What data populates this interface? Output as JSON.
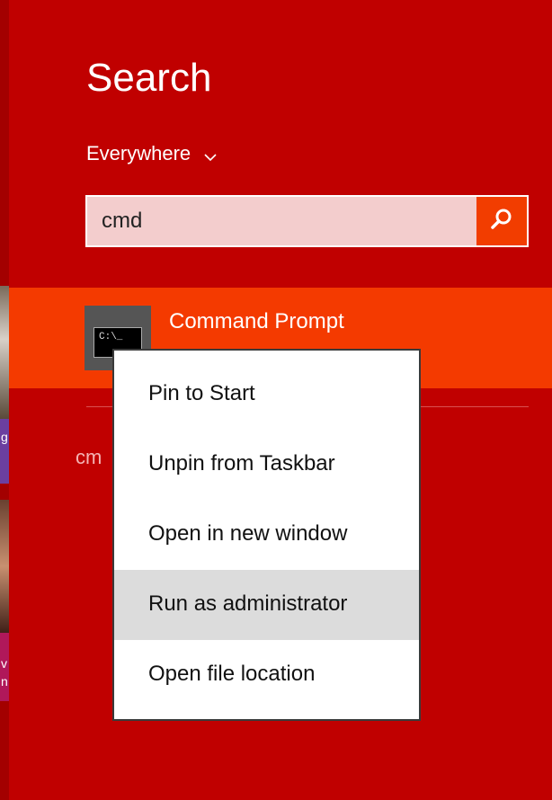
{
  "search": {
    "title": "Search",
    "scope": "Everywhere",
    "query": "cmd"
  },
  "result": {
    "label": "Command Prompt",
    "icon_text": "C:\\_"
  },
  "suggestion": "cm",
  "context_menu": {
    "items": [
      {
        "label": "Pin to Start"
      },
      {
        "label": "Unpin from Taskbar"
      },
      {
        "label": "Open in new window"
      },
      {
        "label": "Run as administrator",
        "highlighted": true
      },
      {
        "label": "Open file location"
      }
    ]
  },
  "background_strip": {
    "chars": [
      "g",
      "v",
      "n"
    ]
  },
  "colors": {
    "background": "#c00000",
    "accent": "#f43a00",
    "menu_highlight": "#dcdcdc"
  }
}
